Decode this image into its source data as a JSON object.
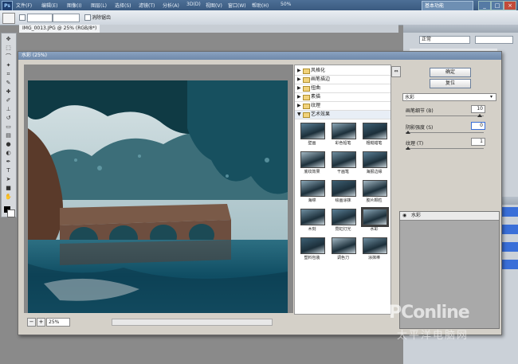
{
  "app": {
    "logo": "Ps",
    "menus": [
      "文件(F)",
      "编辑(E)",
      "图像(I)",
      "图层(L)",
      "选择(S)",
      "滤镜(T)",
      "分析(A)",
      "3D(D)",
      "视图(V)",
      "窗口(W)",
      "帮助(H)"
    ],
    "zoom": "50%",
    "workspace": "基本功能",
    "window_controls": [
      "_",
      "□",
      "×"
    ]
  },
  "options_bar": {
    "combo1": "",
    "combo2": "",
    "check_label": "消除锯齿"
  },
  "document_tab": "IMG_0013.JPG @ 25% (RGB/8*)",
  "right_panel": {
    "mode_value": "正常",
    "rows": [
      "",
      "",
      "",
      ""
    ]
  },
  "dialog": {
    "title": "水彩 (25%)",
    "ok_label": "确定",
    "cancel_label": "复位",
    "zoom_minus": "−",
    "zoom_plus": "+",
    "zoom_value": "25%",
    "categories": [
      {
        "label": "风格化",
        "tri": "▶"
      },
      {
        "label": "画笔描边",
        "tri": "▶"
      },
      {
        "label": "扭曲",
        "tri": "▶"
      },
      {
        "label": "素描",
        "tri": "▶"
      },
      {
        "label": "纹理",
        "tri": "▶"
      },
      {
        "label": "艺术效果",
        "tri": "▼"
      }
    ],
    "filters": [
      "壁画",
      "彩色铅笔",
      "粗糙蜡笔",
      "底纹效果",
      "干画笔",
      "海报边缘",
      "海绵",
      "绘画涂抹",
      "胶片颗粒",
      "木刻",
      "霓虹灯光",
      "水彩",
      "塑料包装",
      "调色刀",
      "涂抹棒"
    ],
    "selected_filter": "水彩",
    "filter_select_value": "水彩",
    "params": [
      {
        "label": "画笔细节 (B)",
        "value": "10"
      },
      {
        "label": "阴影强度 (S)",
        "value": "0"
      },
      {
        "label": "纹理 (T)",
        "value": "1"
      }
    ],
    "layer_label": "水彩"
  },
  "watermark": {
    "main": "PConline",
    "sub": "太平洋电脑网"
  },
  "colors": {
    "accent": "#3a6fd8",
    "title_bar": "#4d6f96",
    "dialog_bg": "#d4d0c8"
  }
}
